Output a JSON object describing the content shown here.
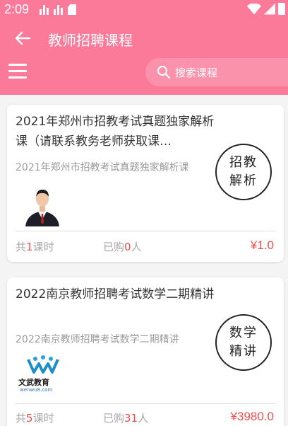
{
  "status_bar": {
    "time": "2:09"
  },
  "header": {
    "title": "教师招聘课程",
    "search_placeholder": "搜索课程"
  },
  "courses": [
    {
      "title": "2021年郑州市招教考试真题独家解析课（请联系教务老师获取课…",
      "subtitle": "2021年郑州市招教考试真题独家解析课",
      "seal": [
        "招教",
        "解析"
      ],
      "lessons_prefix": "共",
      "lessons": "1",
      "lessons_suffix": "课时",
      "bought_prefix": "已购",
      "bought": "0",
      "bought_suffix": "人",
      "price": "¥1.0"
    },
    {
      "title": "2022南京教师招聘考试数学二期精讲",
      "subtitle": "2022南京教师招聘考试数学二期精讲",
      "seal": [
        "数学",
        "精讲"
      ],
      "logo_text": "文武教育",
      "logo_sub": "wenwu8.com",
      "lessons_prefix": "共",
      "lessons": "5",
      "lessons_suffix": "课时",
      "bought_prefix": "已购",
      "bought": "31",
      "bought_suffix": "人",
      "price": "¥3980.0"
    }
  ],
  "colors": {
    "header": "#fb7a9a",
    "accent": "#ee4d4d"
  }
}
